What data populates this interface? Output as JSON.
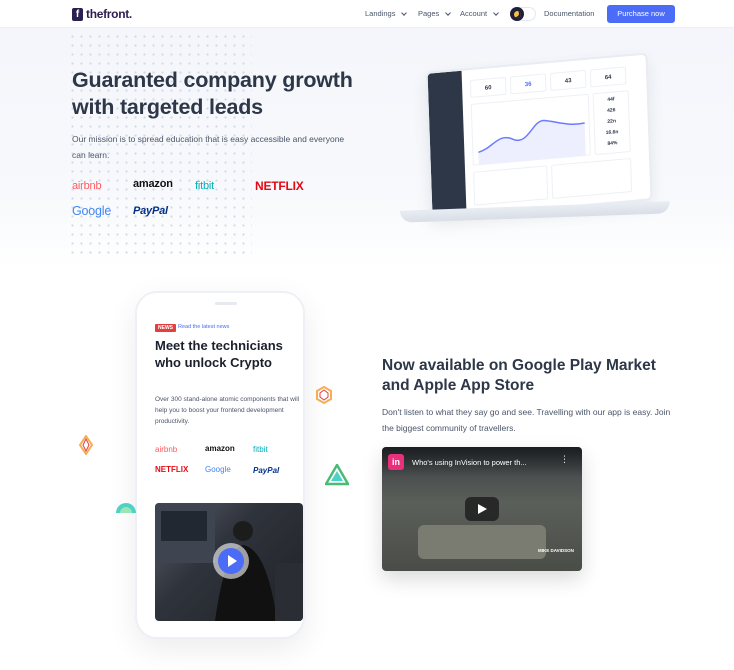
{
  "header": {
    "logo_mark": "f",
    "logo_text": "thefront.",
    "nav": [
      "Landings",
      "Pages",
      "Account"
    ],
    "documentation": "Documentation",
    "purchase": "Purchase now"
  },
  "hero": {
    "title": "Guaranted company growth with targeted leads",
    "subtitle": "Our mission is to spread education that is easy accessible and everyone can learn.",
    "brands": [
      "airbnb",
      "amazon",
      "fitbit",
      "NETFLIX",
      "Google",
      "PayPal"
    ]
  },
  "dashboard": {
    "stats": [
      "60",
      "36",
      "43",
      "64"
    ],
    "side_values": [
      "44f",
      "426",
      "22n",
      "16.6n",
      "84%"
    ]
  },
  "phone": {
    "badge": "NEWS",
    "link": "Read the latest news",
    "title": "Meet the technicians who unlock Crypto",
    "text": "Over 300 stand-alone atomic components that will help you to boost your frontend development productivity.",
    "brands": [
      "airbnb",
      "amazon",
      "fitbit",
      "NETFLIX",
      "Google",
      "PayPal"
    ]
  },
  "section": {
    "title": "Now available on Google Play Market and Apple App Store",
    "subtitle": "Don't listen to what they say go and see. Travelling with our app is easy. Join the biggest community of travellers."
  },
  "video": {
    "title": "Who's using InVision to power th...",
    "caption": "MIKE DAVIDSON"
  },
  "colors": {
    "accent": "#4a6cf7",
    "dark": "#2d3748"
  }
}
